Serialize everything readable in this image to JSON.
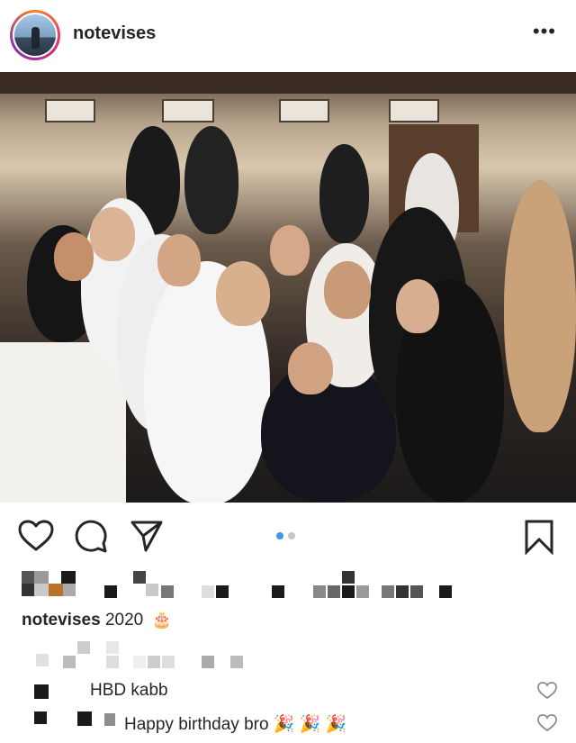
{
  "post": {
    "username": "notevises",
    "more_label": "•••",
    "caption": {
      "username": "notevises",
      "text": "2020",
      "emoji": "🎂"
    },
    "carousel": {
      "count": 2,
      "active_index": 0
    }
  },
  "comments": [
    {
      "text": "HBD kabb"
    },
    {
      "text": "Happy birthday bro",
      "emoji": "🎉 🎉 🎉"
    }
  ],
  "colors": {
    "text": "#262626",
    "carousel_active": "#3897f0",
    "carousel_inactive": "#c7c7c7",
    "heart_outline": "#8e8e8e"
  },
  "icons": {
    "like": "heart-icon",
    "comment": "comment-icon",
    "share": "paper-plane-icon",
    "save": "bookmark-icon",
    "more": "ellipsis-icon"
  }
}
